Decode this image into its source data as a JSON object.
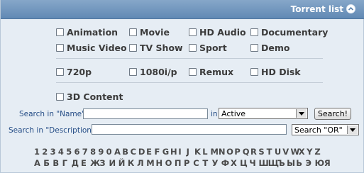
{
  "header": {
    "title": "Torrent list"
  },
  "categories": [
    [
      "Animation",
      "Movie",
      "HD Audio",
      "Documentary"
    ],
    [
      "Music Video",
      "TV Show",
      "Sport",
      "Demo"
    ],
    [
      "720p",
      "1080i/p",
      "Remux",
      "HD Disk"
    ],
    [
      "3D Content"
    ]
  ],
  "search": {
    "name_label": "Search in \"Name\":",
    "in_label": "in",
    "status_selected": "Active",
    "search_button": "Search!",
    "desc_label": "Search in \"Description\":",
    "mode_selected": "Search \"OR\""
  },
  "latin_index": [
    "1",
    "2",
    "3",
    "4",
    "5",
    "6",
    "7",
    "8",
    "9",
    "0",
    "A",
    "B",
    "C",
    "D",
    "E",
    "F",
    "G",
    "H",
    "I",
    "J",
    "K",
    "L",
    "M",
    "N",
    "O",
    "P",
    "Q",
    "R",
    "S",
    "T",
    "U",
    "V",
    "W",
    "X",
    "Y",
    "Z"
  ],
  "cyrillic_index": [
    "А",
    "Б",
    "В",
    "Г",
    "Д",
    "Е",
    "Ж",
    "З",
    "И",
    "Й",
    "К",
    "Л",
    "М",
    "Н",
    "О",
    "П",
    "Р",
    "С",
    "Т",
    "У",
    "Ф",
    "Х",
    "Ц",
    "Ч",
    "Ш",
    "Щ",
    "Ъ",
    "Ы",
    "Ь",
    "Э",
    "Ю",
    "Я"
  ]
}
